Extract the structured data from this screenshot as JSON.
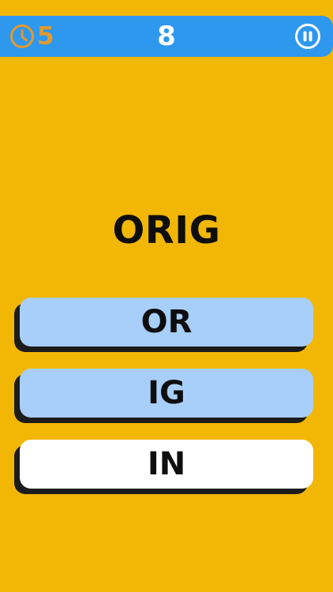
{
  "header": {
    "timer_value": "5",
    "timer_color": "#E29A2C",
    "score": "8",
    "bar_color": "#2E97EE",
    "timer_icon": "clock-icon",
    "pause_icon": "pause-icon"
  },
  "game": {
    "prompt_word": "ORIG",
    "background_color": "#F2B705",
    "options": [
      {
        "label": "OR",
        "color": "#A8CFFA"
      },
      {
        "label": "IG",
        "color": "#A8CFFA"
      },
      {
        "label": "IN",
        "color": "#FFFFFF"
      }
    ]
  }
}
